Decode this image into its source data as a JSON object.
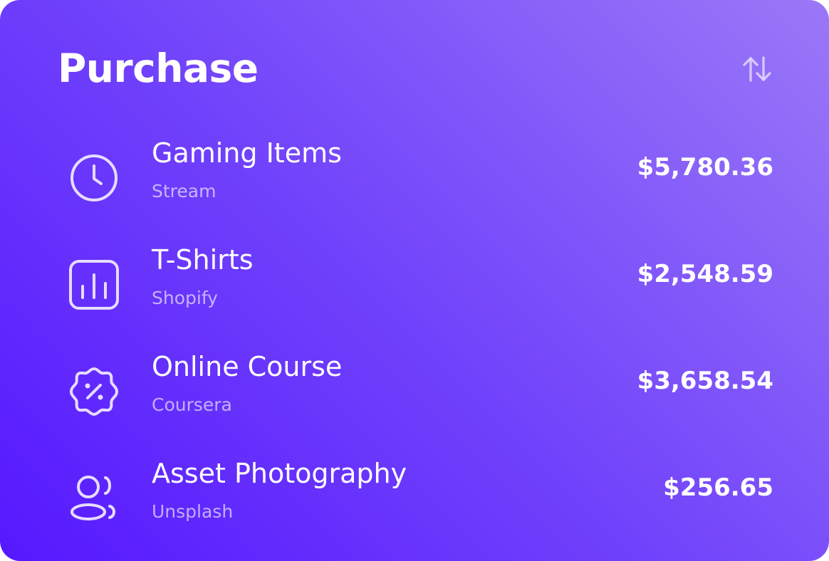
{
  "header": {
    "title": "Purchase",
    "sort_icon": "sort-arrows-icon"
  },
  "purchases": [
    {
      "icon": "clock-icon",
      "name": "Gaming Items",
      "source": "Stream",
      "amount": "$5,780.36"
    },
    {
      "icon": "bar-chart-icon",
      "name": "T-Shirts",
      "source": "Shopify",
      "amount": "$2,548.59"
    },
    {
      "icon": "discount-badge-icon",
      "name": "Online Course",
      "source": "Coursera",
      "amount": "$3,658.54"
    },
    {
      "icon": "users-icon",
      "name": "Asset Photography",
      "source": "Unsplash",
      "amount": "$256.65"
    }
  ],
  "colors": {
    "gradient_start": "#5618ff",
    "gradient_mid": "#6f40fb",
    "gradient_end": "#9a78f7",
    "text": "#ffffff",
    "icon_stroke": "#e6dcff"
  }
}
